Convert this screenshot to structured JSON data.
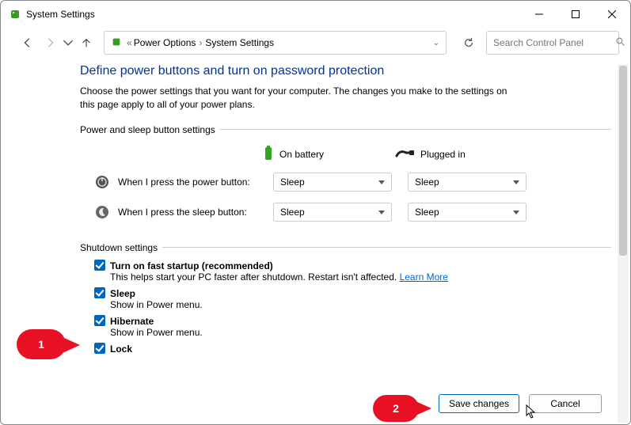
{
  "window": {
    "title": "System Settings"
  },
  "breadcrumb": {
    "root": "Power Options",
    "current": "System Settings"
  },
  "search": {
    "placeholder": "Search Control Panel"
  },
  "page": {
    "heading": "Define power buttons and turn on password protection",
    "description": "Choose the power settings that you want for your computer. The changes you make to the settings on this page apply to all of your power plans."
  },
  "power_button_section": {
    "legend": "Power and sleep button settings",
    "battery_label": "On battery",
    "plugged_label": "Plugged in",
    "rows": [
      {
        "label": "When I press the power button:",
        "battery": "Sleep",
        "plugged": "Sleep"
      },
      {
        "label": "When I press the sleep button:",
        "battery": "Sleep",
        "plugged": "Sleep"
      }
    ]
  },
  "shutdown_section": {
    "legend": "Shutdown settings",
    "options": [
      {
        "label": "Turn on fast startup (recommended)",
        "sub": "This helps start your PC faster after shutdown. Restart isn't affected. ",
        "link": "Learn More"
      },
      {
        "label": "Sleep",
        "sub": "Show in Power menu."
      },
      {
        "label": "Hibernate",
        "sub": "Show in Power menu."
      },
      {
        "label": "Lock",
        "sub": ""
      }
    ]
  },
  "buttons": {
    "save": "Save changes",
    "cancel": "Cancel"
  },
  "callouts": {
    "one": "1",
    "two": "2"
  }
}
